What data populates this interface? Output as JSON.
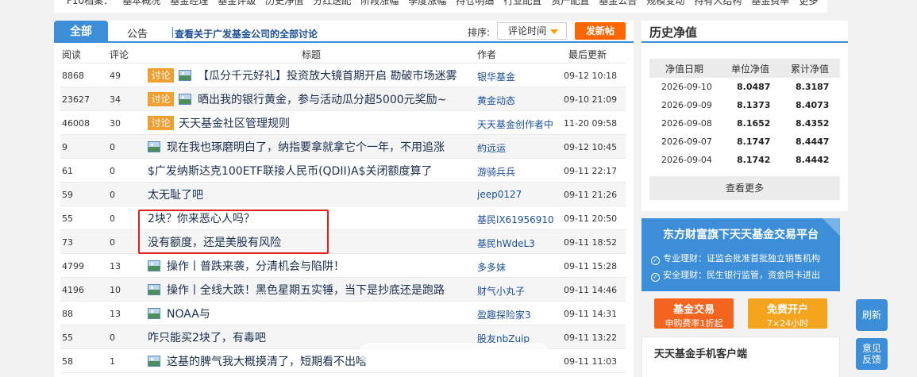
{
  "topnav": {
    "items": [
      "F10档案：",
      "基本概况",
      "基金经理",
      "基金评级",
      "历史净值",
      "分红送配",
      "阶段涨幅",
      "季度涨幅",
      "持仓明细",
      "行业配置",
      "资产配置",
      "基金公告",
      "规模变动",
      "持有人结构",
      "基金费率",
      "更多"
    ],
    "plus": "+"
  },
  "tabs": {
    "all": "全部",
    "notice": "公告",
    "discuss": "查看关于广发基金公司的全部讨论",
    "sort_label": "排序:",
    "sort_value": "评论时间",
    "post": "发新帖"
  },
  "table": {
    "headers": {
      "read": "阅读",
      "comments": "评论",
      "title": "标题",
      "author": "作者",
      "updated": "最后更新"
    },
    "rows": [
      {
        "read": "8868",
        "comments": "49",
        "badge": "讨论",
        "image": true,
        "title": "【瓜分千元好礼】投资放大镜首期开启 勘破市场迷雾",
        "author": "银华基金",
        "date": "09-12 10:18"
      },
      {
        "read": "23627",
        "comments": "34",
        "badge": "讨论",
        "image": true,
        "title": "晒出我的银行黄金，参与活动瓜分超5000元奖励~",
        "author": "黄金动态",
        "date": "09-10 21:09"
      },
      {
        "read": "46008",
        "comments": "30",
        "badge": "讨论",
        "image": false,
        "title": "天天基金社区管理规则",
        "author": "天天基金创作者中",
        "date": "11-20 09:58"
      },
      {
        "read": "9",
        "comments": "0",
        "badge": "",
        "image": true,
        "title": "现在我也琢磨明白了，纳指要拿就拿它个一年，不用追涨",
        "author": "約远运",
        "date": "09-12 10:45"
      },
      {
        "read": "61",
        "comments": "0",
        "badge": "",
        "image": false,
        "title": "$广发纳斯达克100ETF联接人民币(QDII)A$关闭额度算了",
        "author": "游骑兵兵",
        "date": "09-11 22:17"
      },
      {
        "read": "59",
        "comments": "0",
        "badge": "",
        "image": false,
        "title": "太无耻了吧",
        "author": "jeep0127",
        "date": "09-11 21:26"
      },
      {
        "read": "55",
        "comments": "0",
        "badge": "",
        "image": false,
        "title": "2块？你来恶心人吗？",
        "author": "基民lX61956910",
        "date": "09-11 20:50"
      },
      {
        "read": "73",
        "comments": "0",
        "badge": "",
        "image": false,
        "title": "没有额度，还是美股有风险",
        "author": "基民hWdeL3",
        "date": "09-11 18:52"
      },
      {
        "read": "4799",
        "comments": "13",
        "badge": "",
        "image": true,
        "title": "操作丨普跌来袭，分清机会与陷阱！",
        "author": "多多妹",
        "date": "09-11 15:28"
      },
      {
        "read": "4196",
        "comments": "10",
        "badge": "",
        "image": true,
        "title": "操作丨全线大跌！黑色星期五实锤，当下是抄底还是跑路",
        "author": "财气小丸子",
        "date": "09-11 14:46"
      },
      {
        "read": "88",
        "comments": "13",
        "badge": "",
        "image": true,
        "title": "NOAA与",
        "author": "盈趣探险家3",
        "date": "09-11 14:31"
      },
      {
        "read": "55",
        "comments": "0",
        "badge": "",
        "image": false,
        "title": "咋只能买2块了，有毒吧",
        "author": "股友nbZuip",
        "date": "09-11 13:22"
      },
      {
        "read": "58",
        "comments": "1",
        "badge": "",
        "image": true,
        "title": "这基的脾气我大概摸清了，短期看不出啥",
        "author": "",
        "date": "09-11 11:03"
      }
    ]
  },
  "history": {
    "title": "历史净值",
    "headers": {
      "date": "净值日期",
      "unit": "单位净值",
      "acc": "累计净值"
    },
    "rows": [
      {
        "date": "2026-09-10",
        "unit": "8.0487",
        "acc": "8.3187"
      },
      {
        "date": "2026-09-09",
        "unit": "8.1373",
        "acc": "8.4073"
      },
      {
        "date": "2026-09-08",
        "unit": "8.1652",
        "acc": "8.4352"
      },
      {
        "date": "2026-09-07",
        "unit": "8.1747",
        "acc": "8.4447"
      },
      {
        "date": "2026-09-04",
        "unit": "8.1742",
        "acc": "8.4442"
      }
    ],
    "more": "查看更多"
  },
  "promo": {
    "title": "东方财富旗下天天基金交易平台",
    "line1": "专业理财：证监会批准首批独立销售机构",
    "line2": "安全理财：民生银行监管，资金同卡进出",
    "fund_main": "基金交易",
    "fund_sub": "申购费率1折起",
    "open_main": "免费开户",
    "open_sub": "7×24小时"
  },
  "app": {
    "title": "天天基金手机客户端"
  },
  "float": {
    "refresh": "刷新",
    "feedback": "意见反馈"
  },
  "colors": {
    "accent": "#3d8ed9",
    "orange": "#f60",
    "badge": "#f0a030",
    "highlight": "#e02020"
  }
}
